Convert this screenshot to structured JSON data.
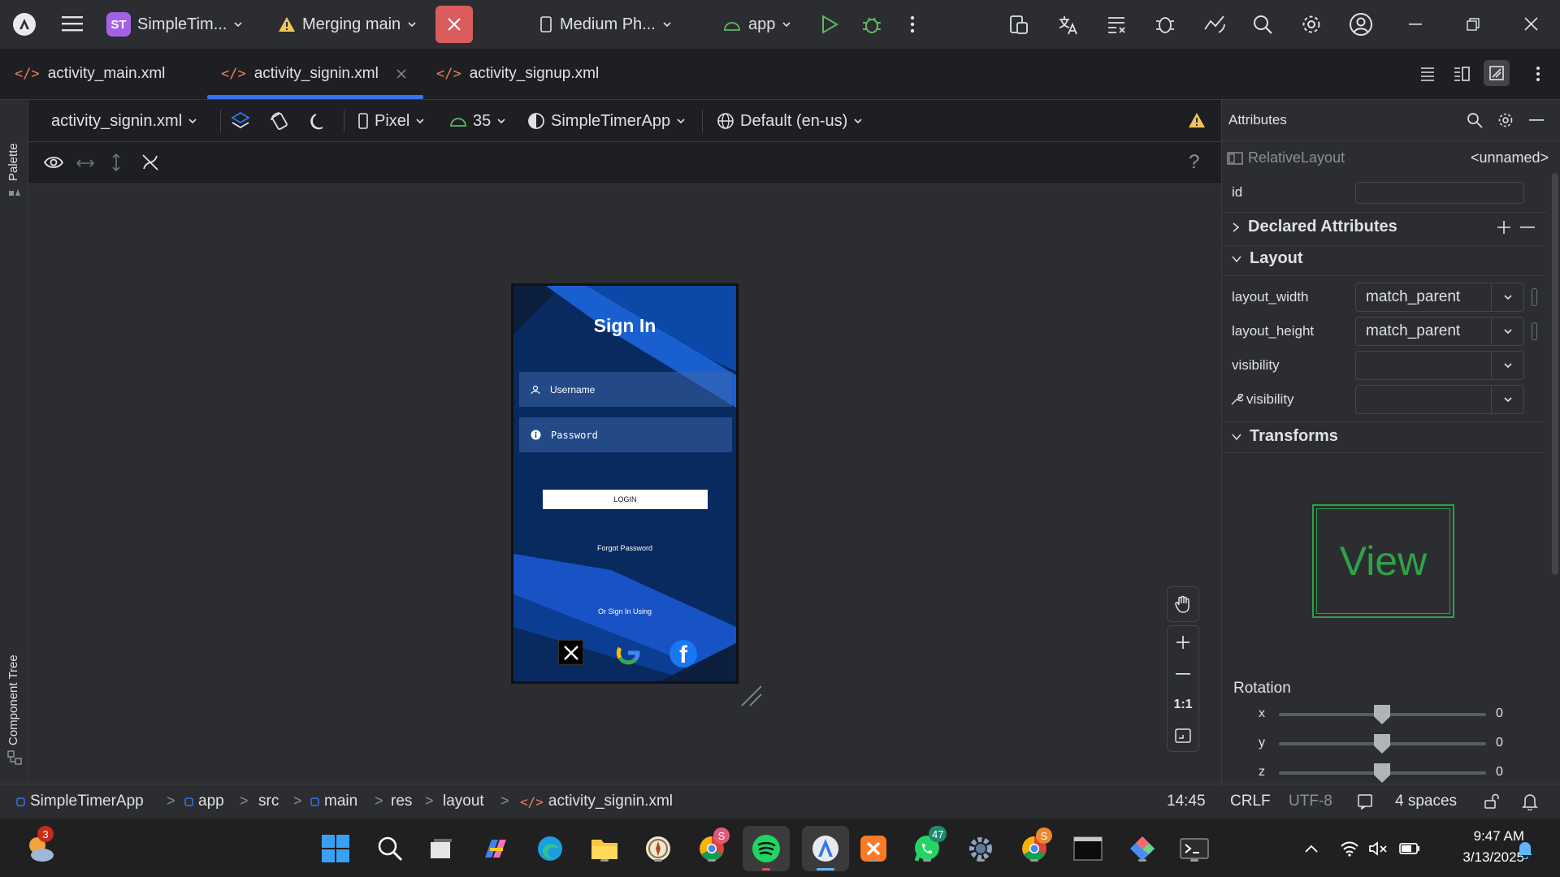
{
  "titlebar": {
    "project_badge": "ST",
    "project_name": "SimpleTim...",
    "vcs_label": "Merging main",
    "device_label": "Medium Ph...",
    "run_config": "app"
  },
  "tabs": [
    {
      "label": "activity_main.xml"
    },
    {
      "label": "activity_signin.xml"
    },
    {
      "label": "activity_signup.xml"
    }
  ],
  "left_strip": {
    "palette": "Palette",
    "component_tree": "Component Tree"
  },
  "design_toolbar": {
    "file": "activity_signin.xml",
    "device": "Pixel",
    "api": "35",
    "theme": "SimpleTimerApp",
    "locale": "Default (en-us)"
  },
  "phone": {
    "title": "Sign In",
    "username_hint": "Username",
    "password_hint": "Password",
    "login_label": "LOGIN",
    "forgot_label": "Forgot Password",
    "or_label": "Or Sign In Using"
  },
  "zoom": {
    "one_to_one": "1:1"
  },
  "attributes": {
    "header": "Attributes",
    "component": "RelativeLayout",
    "component_name": "<unnamed>",
    "id_label": "id",
    "id_value": "",
    "declared_header": "Declared Attributes",
    "layout_header": "Layout",
    "layout_width_label": "layout_width",
    "layout_width_value": "match_parent",
    "layout_height_label": "layout_height",
    "layout_height_value": "match_parent",
    "visibility_label": "visibility",
    "visibility_value": "",
    "tools_visibility_label": "visibility",
    "tools_visibility_value": "",
    "transforms_header": "Transforms",
    "preview_text": "View",
    "rotation_label": "Rotation",
    "rotation": [
      {
        "axis": "x",
        "value": "0"
      },
      {
        "axis": "y",
        "value": "0"
      },
      {
        "axis": "z",
        "value": "0"
      }
    ]
  },
  "statusbar": {
    "crumbs": [
      "SimpleTimerApp",
      "app",
      "src",
      "main",
      "res",
      "layout",
      "activity_signin.xml"
    ],
    "position": "14:45",
    "line_sep": "CRLF",
    "encoding": "UTF-8",
    "indent": "4 spaces"
  },
  "taskbar": {
    "weather_badge": "3",
    "chrome_badge": "S",
    "whatsapp_badge": "47",
    "chrome2_badge": "S",
    "time": "9:47 AM",
    "date": "3/13/2025"
  },
  "colors": {
    "accent": "#3574f0",
    "close_red": "#db5c5c",
    "phone_bg": "#0a2a5c",
    "view_green": "#2fa14a"
  }
}
